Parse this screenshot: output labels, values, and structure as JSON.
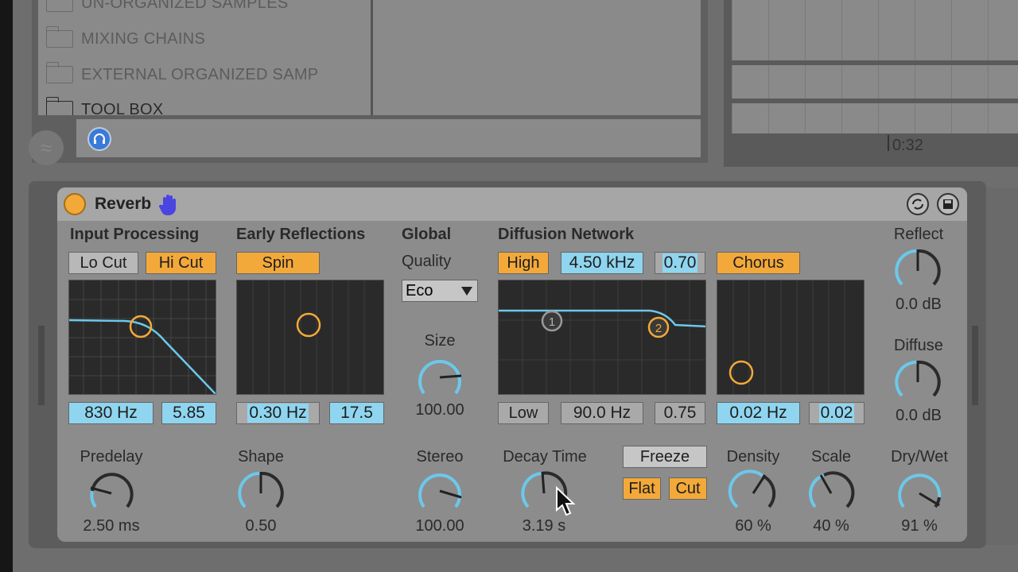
{
  "browser": {
    "items": [
      {
        "label": "UN-ORGANIZED SAMPLES"
      },
      {
        "label": "MIXING CHAINS"
      },
      {
        "label": "EXTERNAL ORGANIZED SAMP"
      },
      {
        "label": "TOOL BOX"
      }
    ]
  },
  "arrangement": {
    "time_marker": "0:32"
  },
  "device": {
    "title": "Reverb",
    "sections": {
      "input_processing": "Input Processing",
      "early_reflections": "Early Reflections",
      "global": "Global",
      "quality_label": "Quality",
      "diffusion_network": "Diffusion Network"
    },
    "input": {
      "lo_cut": "Lo Cut",
      "hi_cut": "Hi Cut",
      "freq": "830 Hz",
      "width": "5.85"
    },
    "early": {
      "spin": "Spin",
      "amount": "0.30 Hz",
      "depth": "17.5"
    },
    "global": {
      "quality": "Eco",
      "size_label": "Size",
      "size_value": "100.00"
    },
    "diffusion": {
      "high_button": "High",
      "high_freq": "4.50 kHz",
      "high_value": "0.70",
      "chorus": "Chorus",
      "low_button": "Low",
      "low_freq": "90.0 Hz",
      "low_value": "0.75",
      "chorus_amount": "0.02 Hz",
      "chorus_depth": "0.02",
      "node1": "1",
      "node2": "2"
    },
    "reflect": {
      "label": "Reflect",
      "value": "0.0 dB"
    },
    "diffuse": {
      "label": "Diffuse",
      "value": "0.0 dB"
    },
    "bottom": {
      "predelay": {
        "label": "Predelay",
        "value": "2.50 ms"
      },
      "shape": {
        "label": "Shape",
        "value": "0.50"
      },
      "stereo": {
        "label": "Stereo",
        "value": "100.00"
      },
      "decay": {
        "label": "Decay Time",
        "value": "3.19 s"
      },
      "freeze": "Freeze",
      "flat": "Flat",
      "cut": "Cut",
      "density": {
        "label": "Density",
        "value": "60 %"
      },
      "scale": {
        "label": "Scale",
        "value": "40 %"
      },
      "drywet": {
        "label": "Dry/Wet",
        "value": "91 %"
      }
    }
  },
  "colors": {
    "accent_orange": "#f3a93a",
    "accent_blue": "#8fd5ef",
    "curve_blue": "#6cc8ea",
    "display_bg": "#2a2a2a"
  }
}
